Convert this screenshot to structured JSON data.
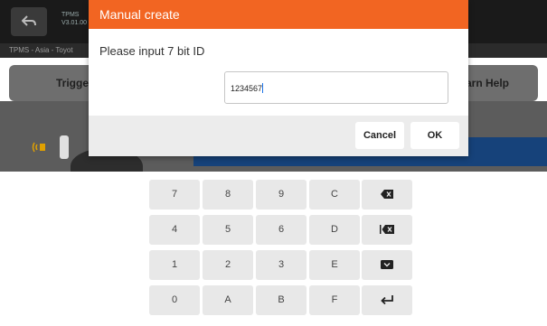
{
  "app": {
    "title_line1": "TPMS",
    "title_line2": "V3.01.00",
    "breadcrumb": "TPMS - Asia - Toyot",
    "tab_left": "Trigge",
    "tab_right": "arn Help"
  },
  "dialog": {
    "title": "Manual create",
    "prompt": "Please input 7 bit ID",
    "input_value": "1234567",
    "cancel_label": "Cancel",
    "ok_label": "OK"
  },
  "keypad": {
    "rows": [
      [
        "7",
        "8",
        "9",
        "C"
      ],
      [
        "4",
        "5",
        "6",
        "D"
      ],
      [
        "1",
        "2",
        "3",
        "E"
      ],
      [
        "0",
        "A",
        "B",
        "F"
      ]
    ],
    "special_keys": [
      "backspace-icon",
      "clear-icon",
      "hide-keyboard-icon",
      "enter-icon"
    ]
  },
  "colors": {
    "accent": "#f26522",
    "keypad_key": "#e8e8e8",
    "dialog_footer": "#ececec"
  }
}
